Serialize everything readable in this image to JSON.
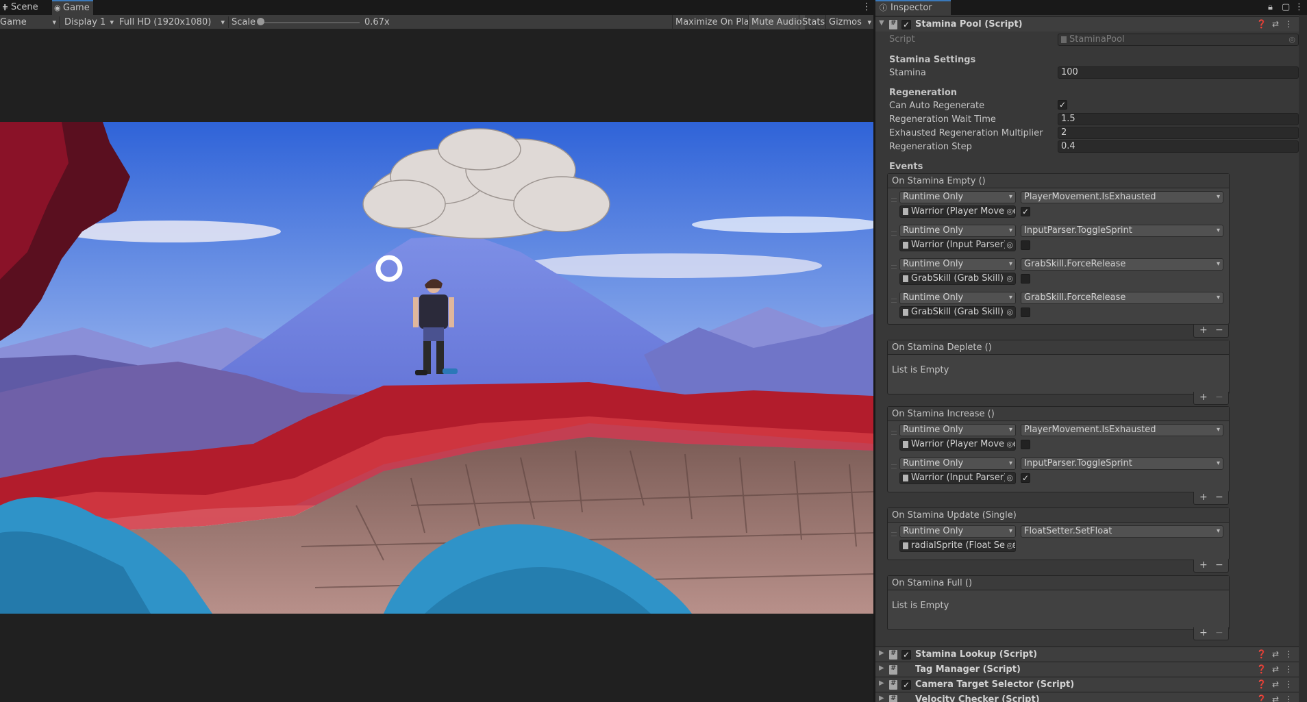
{
  "game_window": {
    "tabs": [
      {
        "label": "Scene",
        "icon": "scene-icon"
      },
      {
        "label": "Game",
        "icon": "game-controller-icon"
      }
    ],
    "toolbar": {
      "mode": "Game",
      "display": "Display 1",
      "resolution": "Full HD (1920x1080)",
      "scale_label": "Scale",
      "scale_value": "0.67x",
      "scale_fraction": 0.0,
      "buttons": [
        "Maximize On Play",
        "Mute Audio",
        "Stats",
        "Gizmos"
      ]
    }
  },
  "inspector": {
    "tab_label": "Inspector",
    "component": {
      "title": "Stamina Pool (Script)",
      "enabled": true,
      "script_label": "Script",
      "script_value": "StaminaPool",
      "stamina_settings_header": "Stamina Settings",
      "stamina_label": "Stamina",
      "stamina_value": "100",
      "regeneration_header": "Regeneration",
      "can_auto_regenerate_label": "Can Auto Regenerate",
      "can_auto_regenerate": true,
      "wait_time_label": "Regeneration Wait Time",
      "wait_time_value": "1.5",
      "exhausted_mult_label": "Exhausted Regeneration Multiplier",
      "exhausted_mult_value": "2",
      "step_label": "Regeneration Step",
      "step_value": "0.4",
      "events_header": "Events",
      "empty_text": "List is Empty",
      "events": {
        "on_empty": {
          "title": "On Stamina Empty ()",
          "rows": [
            {
              "mode": "Runtime Only",
              "target": "Warrior (Player Movemen",
              "method": "PlayerMovement.IsExhausted",
              "checked": true
            },
            {
              "mode": "Runtime Only",
              "target": "Warrior (Input Parser)",
              "method": "InputParser.ToggleSprint",
              "checked": false
            },
            {
              "mode": "Runtime Only",
              "target": "GrabSkill (Grab Skill)",
              "method": "GrabSkill.ForceRelease",
              "checked": false
            },
            {
              "mode": "Runtime Only",
              "target": "GrabSkill (Grab Skill)",
              "method": "GrabSkill.ForceRelease",
              "checked": false
            }
          ]
        },
        "on_deplete": {
          "title": "On Stamina Deplete ()"
        },
        "on_increase": {
          "title": "On Stamina Increase ()",
          "rows": [
            {
              "mode": "Runtime Only",
              "target": "Warrior (Player Movemen",
              "method": "PlayerMovement.IsExhausted",
              "checked": false
            },
            {
              "mode": "Runtime Only",
              "target": "Warrior (Input Parser)",
              "method": "InputParser.ToggleSprint",
              "checked": true
            }
          ]
        },
        "on_update": {
          "title": "On Stamina Update (Single)",
          "rows": [
            {
              "mode": "Runtime Only",
              "target": "radialSprite (Float Setter)",
              "method": "FloatSetter.SetFloat"
            }
          ]
        },
        "on_full": {
          "title": "On Stamina Full ()"
        }
      }
    },
    "collapsed_components": [
      {
        "title": "Stamina Lookup (Script)",
        "enabled": true
      },
      {
        "title": "Tag Manager (Script)",
        "enabled": null
      },
      {
        "title": "Camera Target Selector (Script)",
        "enabled": true
      },
      {
        "title": "Velocity Checker (Script)",
        "enabled": null
      }
    ]
  }
}
